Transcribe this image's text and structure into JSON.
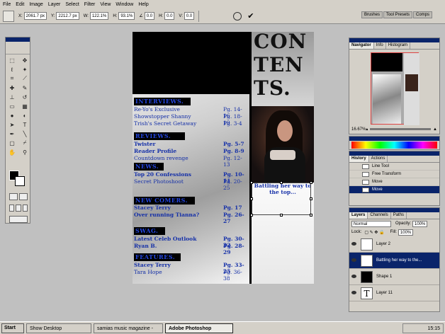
{
  "menu": [
    "File",
    "Edit",
    "Image",
    "Layer",
    "Select",
    "Filter",
    "View",
    "Window",
    "Help"
  ],
  "options": {
    "x_label": "X:",
    "x_value": "2061.7 px",
    "y_label": "Y:",
    "y_value": "2212.7 px",
    "w_label": "W:",
    "w_value": "122.1%",
    "h_label": "H:",
    "h_value": "93.1%",
    "angle_value": "0.0",
    "hskew_label": "H:",
    "hskew_value": "0.0",
    "vskew_label": "V:",
    "vskew_value": "0.0",
    "palette_tabs": [
      "Brushes",
      "Tool Presets",
      "Comps"
    ]
  },
  "document": {
    "contents_lines": [
      "CON",
      "TEN",
      "TS."
    ],
    "caption": "Battling her way to the top...",
    "sections": [
      {
        "heading": "INTERVIEWS.",
        "rows": [
          {
            "title": "Re-Yo's Exclusive",
            "page": "Pg. 14-16",
            "bold": false
          },
          {
            "title": "Showstopper Shanny",
            "page": "Pg. 18-19",
            "bold": false
          },
          {
            "title": "Trish's Secret Getaway",
            "page": "Pg. 3-4",
            "bold": false
          }
        ]
      },
      {
        "heading": "REVIEWS.",
        "rows": [
          {
            "title": "Twister",
            "page": "Pg. 5-7",
            "bold": true
          },
          {
            "title": "Reader Profile",
            "page": "Pg. 8-9",
            "bold": true
          },
          {
            "title": "Countdown revenge",
            "page": "Pg. 12-13",
            "bold": false
          }
        ]
      },
      {
        "heading": "NEWS.",
        "rows": [
          {
            "title": "Top 20 Confessions",
            "page": "Pg. 10-11",
            "bold": true
          },
          {
            "title": "Secret Photoshoot",
            "page": "Pg. 20-25",
            "bold": false
          }
        ]
      },
      {
        "heading": "NEW COMERS.",
        "rows": [
          {
            "title": "Stacey Terry",
            "page": "Pg. 17",
            "bold": true
          },
          {
            "title": "Over running Tianna?",
            "page": "Pg. 26-27",
            "bold": true
          }
        ]
      },
      {
        "heading": "SWAG.",
        "rows": [
          {
            "title": "Latest Celeb Outlook",
            "page": "Pg. 30-32",
            "bold": true
          },
          {
            "title": "Ryan B.",
            "page": "Pg. 28-29",
            "bold": true
          }
        ]
      },
      {
        "heading": "FEATURES.",
        "rows": [
          {
            "title": "Stacey Terry",
            "page": "Pg. 33-25",
            "bold": true
          },
          {
            "title": "Tara Hope",
            "page": "Pg. 36-38",
            "bold": false
          }
        ]
      }
    ]
  },
  "navigator": {
    "tabs": [
      "Navigator",
      "Info",
      "Histogram"
    ],
    "zoom": "16.67%"
  },
  "history": {
    "tabs": [
      "History",
      "Actions"
    ],
    "items": [
      {
        "label": "Line Tool",
        "selected": false
      },
      {
        "label": "Free Transform",
        "selected": false
      },
      {
        "label": "Move",
        "selected": false
      },
      {
        "label": "Move",
        "selected": true
      }
    ]
  },
  "layers": {
    "tabs": [
      "Layers",
      "Channels",
      "Paths"
    ],
    "blend_mode": "Normal",
    "opacity_label": "Opacity:",
    "opacity": "100%",
    "lock_label": "Lock:",
    "fill_label": "Fill:",
    "fill": "100%",
    "items": [
      {
        "name": "Layer 2",
        "thumb": "",
        "selected": false
      },
      {
        "name": "Battling her way to the...",
        "thumb": "T",
        "selected": true
      },
      {
        "name": "Shape 1",
        "thumb": "",
        "selected": false
      },
      {
        "name": "Layer 11",
        "thumb": "T",
        "selected": false
      }
    ]
  },
  "taskbar": {
    "start": "Start",
    "tasks": [
      "Show Desktop",
      "samias music magazine -",
      "Adobe Photoshop"
    ],
    "time": "15:15"
  },
  "colors": {
    "accent": "#0a246a",
    "text_blue": "#1530a8",
    "heading_blue": "#2446e0"
  }
}
